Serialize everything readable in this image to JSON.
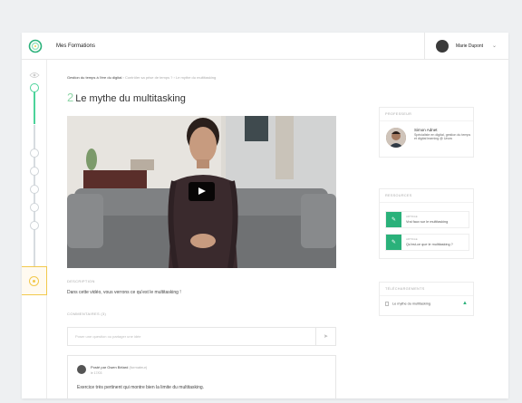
{
  "app": {
    "title": "Mes Formations"
  },
  "user": {
    "name": "Marie Dupont"
  },
  "breadcrumb": {
    "course": "Gestion du temps à l'ère du digital",
    "module": "Contrôler sa prise de temps ?",
    "lesson": "Le mythe du multitasking"
  },
  "lesson": {
    "number": "2",
    "title": "Le mythe du multitasking"
  },
  "description": {
    "label": "DESCRIPTION",
    "text": "Dans cette vidéo, vous verrons ce qu'est le multitasking !"
  },
  "comments": {
    "label": "COMMENTAIRES (3)",
    "placeholder": "Poser une question ou partager une idée",
    "items": [
      {
        "author": "Posté par Gwen Bélard",
        "role": "(formateur)",
        "date": "le 17/03",
        "text": "Exercice très pertinent qui montre bien la limite du multitasking."
      }
    ]
  },
  "sidebar": {
    "professor": {
      "label": "PROFESSEUR",
      "name": "Simon Adnet",
      "bio": "Spécialiste en digital, gestion du temps et digital learning @ Unow"
    },
    "resources": {
      "label": "RESSOURCES",
      "items": [
        {
          "category": "ARTICLE",
          "label": "Vrai faux sur le multitasking"
        },
        {
          "category": "ARTICLE",
          "label": "Qu'est-ce que le multitasking ?"
        }
      ]
    },
    "downloads": {
      "label": "TÉLÉCHARGEMENTS",
      "items": [
        {
          "label": "Le mythe du multitasking"
        }
      ]
    }
  },
  "colors": {
    "accent": "#2ab17a",
    "highlight": "#f2c94c",
    "progress": "#4cd39a"
  }
}
